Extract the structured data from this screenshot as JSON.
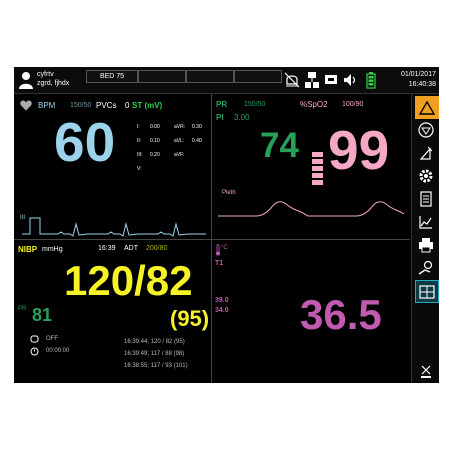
{
  "patient": {
    "name_line1": "cyfrtv",
    "name_line2": "zgrd, fjhdx"
  },
  "bed": "BED 75",
  "datetime": {
    "date": "01/01/2017",
    "time": "16:40:38"
  },
  "ecg": {
    "hr_label": "BPM",
    "hr_range": "150/50",
    "pvcs_label": "PVCs",
    "pvcs_value": "0",
    "st_label": "ST (mV)",
    "hr_value": "60",
    "lead_label": "III",
    "st_rows": [
      {
        "lead": "I:",
        "value": "0.00",
        "lead2": "aVR:",
        "value2": "0.30"
      },
      {
        "lead": "II:",
        "value": "0.10",
        "lead2": "aVL:",
        "value2": "0.40"
      },
      {
        "lead": "III:",
        "value": "0.20",
        "lead2": "aVF:",
        "value2": ""
      },
      {
        "lead": "V:",
        "value": "",
        "lead2": "",
        "value2": ""
      }
    ]
  },
  "spo2": {
    "pr_label": "PR",
    "pr_range": "150/50",
    "spo2_label": "%SpO2",
    "spo2_range": "100/90",
    "pi_label": "PI",
    "pi_value": "3.00",
    "pr_value": "74",
    "spo2_value": "99",
    "pleth_label": "Pleth",
    "bar_level": 0.5
  },
  "nibp": {
    "label": "NIBP",
    "unit": "mmHg",
    "time": "16:39",
    "mode": "ADT",
    "limits": "200/80",
    "value": "120/82",
    "mean": "(95)",
    "pr_label": "PR",
    "pr_value": "81",
    "timer_state": "OFF",
    "timer_value": "00:00:00",
    "history": [
      "16:39:44; 120 / 82 (95)",
      "16:39:49; 117 / 88 (98)",
      "16:38:55; 117 / 93 (101)"
    ]
  },
  "temp": {
    "unit": "°C",
    "channel": "T1",
    "upper_limit": "39.0",
    "lower_limit": "34.0",
    "value": "36.5"
  },
  "colors": {
    "ecg": "#9dd3ea",
    "spo2_pr": "#27a05a",
    "spo2": "#f4a8c6",
    "nibp": "#f5f226",
    "temp": "#c05bb0",
    "alarm": "#f0a020"
  }
}
